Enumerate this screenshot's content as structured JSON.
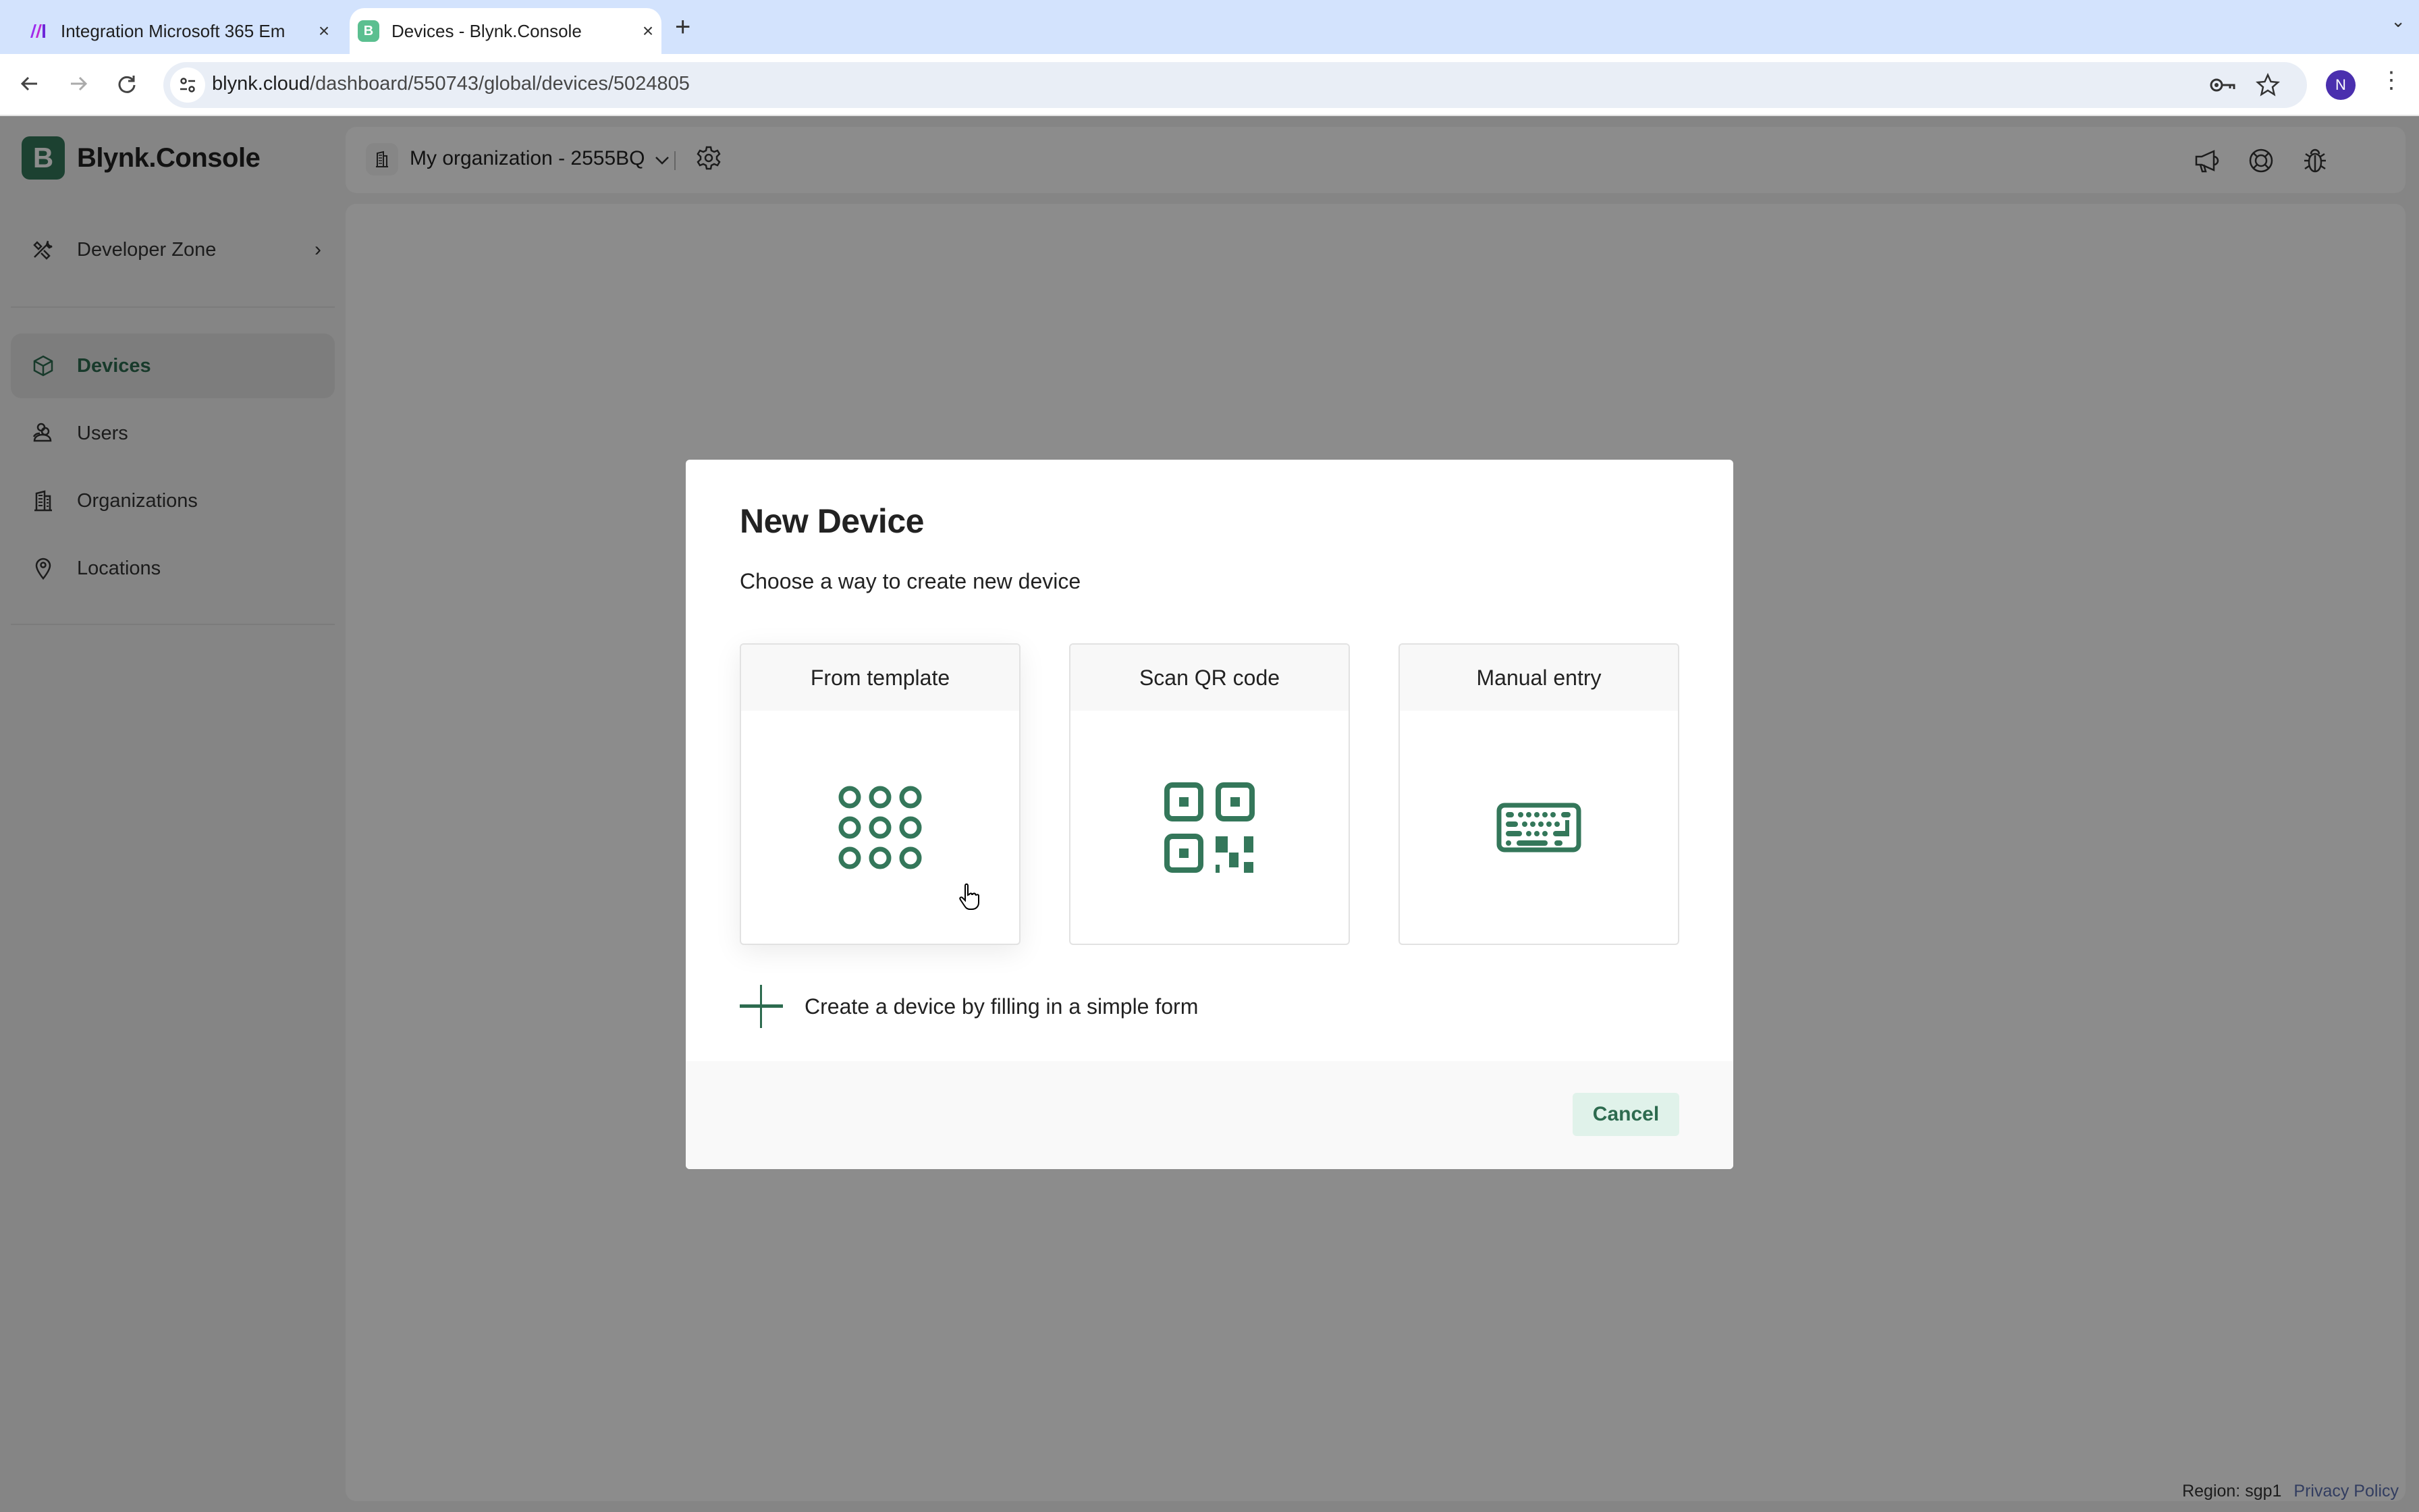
{
  "browser": {
    "tabs": [
      {
        "title": "Integration Microsoft 365 Em",
        "favicon": "make-logo-icon",
        "active": false
      },
      {
        "title": "Devices - Blynk.Console",
        "favicon": "B",
        "active": true
      }
    ],
    "new_tab_icon": "+",
    "url_host": "blynk.cloud",
    "url_path": "/dashboard/550743/global/devices/5024805",
    "profile_initial": "N"
  },
  "app": {
    "logo_letter": "B",
    "logo_text": "Blynk.Console",
    "sidebar": {
      "developer_zone": "Developer Zone",
      "items": [
        {
          "label": "Devices",
          "icon": "cube-icon",
          "active": true
        },
        {
          "label": "Users",
          "icon": "users-icon",
          "active": false
        },
        {
          "label": "Organizations",
          "icon": "building-icon",
          "active": false
        },
        {
          "label": "Locations",
          "icon": "location-pin-icon",
          "active": false
        }
      ]
    },
    "header": {
      "org_name": "My organization - 2555BQ",
      "icons": [
        "megaphone-icon",
        "lifebuoy-icon",
        "bug-icon",
        "avatar"
      ]
    },
    "footer": {
      "region": "Region: sgp1",
      "privacy": "Privacy Policy"
    },
    "colors": {
      "brand_green": "#34775a",
      "accent_green": "#2d6b4f",
      "cancel_bg": "#e0f2ea",
      "link": "#5b6fb0"
    }
  },
  "modal": {
    "title": "New Device",
    "subtitle": "Choose a way to create new device",
    "options": [
      {
        "label": "From template",
        "icon": "template-grid-icon"
      },
      {
        "label": "Scan QR code",
        "icon": "qr-code-icon"
      },
      {
        "label": "Manual entry",
        "icon": "keyboard-icon"
      }
    ],
    "simple_form_label": "Create a device by filling in a simple form",
    "cancel_label": "Cancel"
  }
}
